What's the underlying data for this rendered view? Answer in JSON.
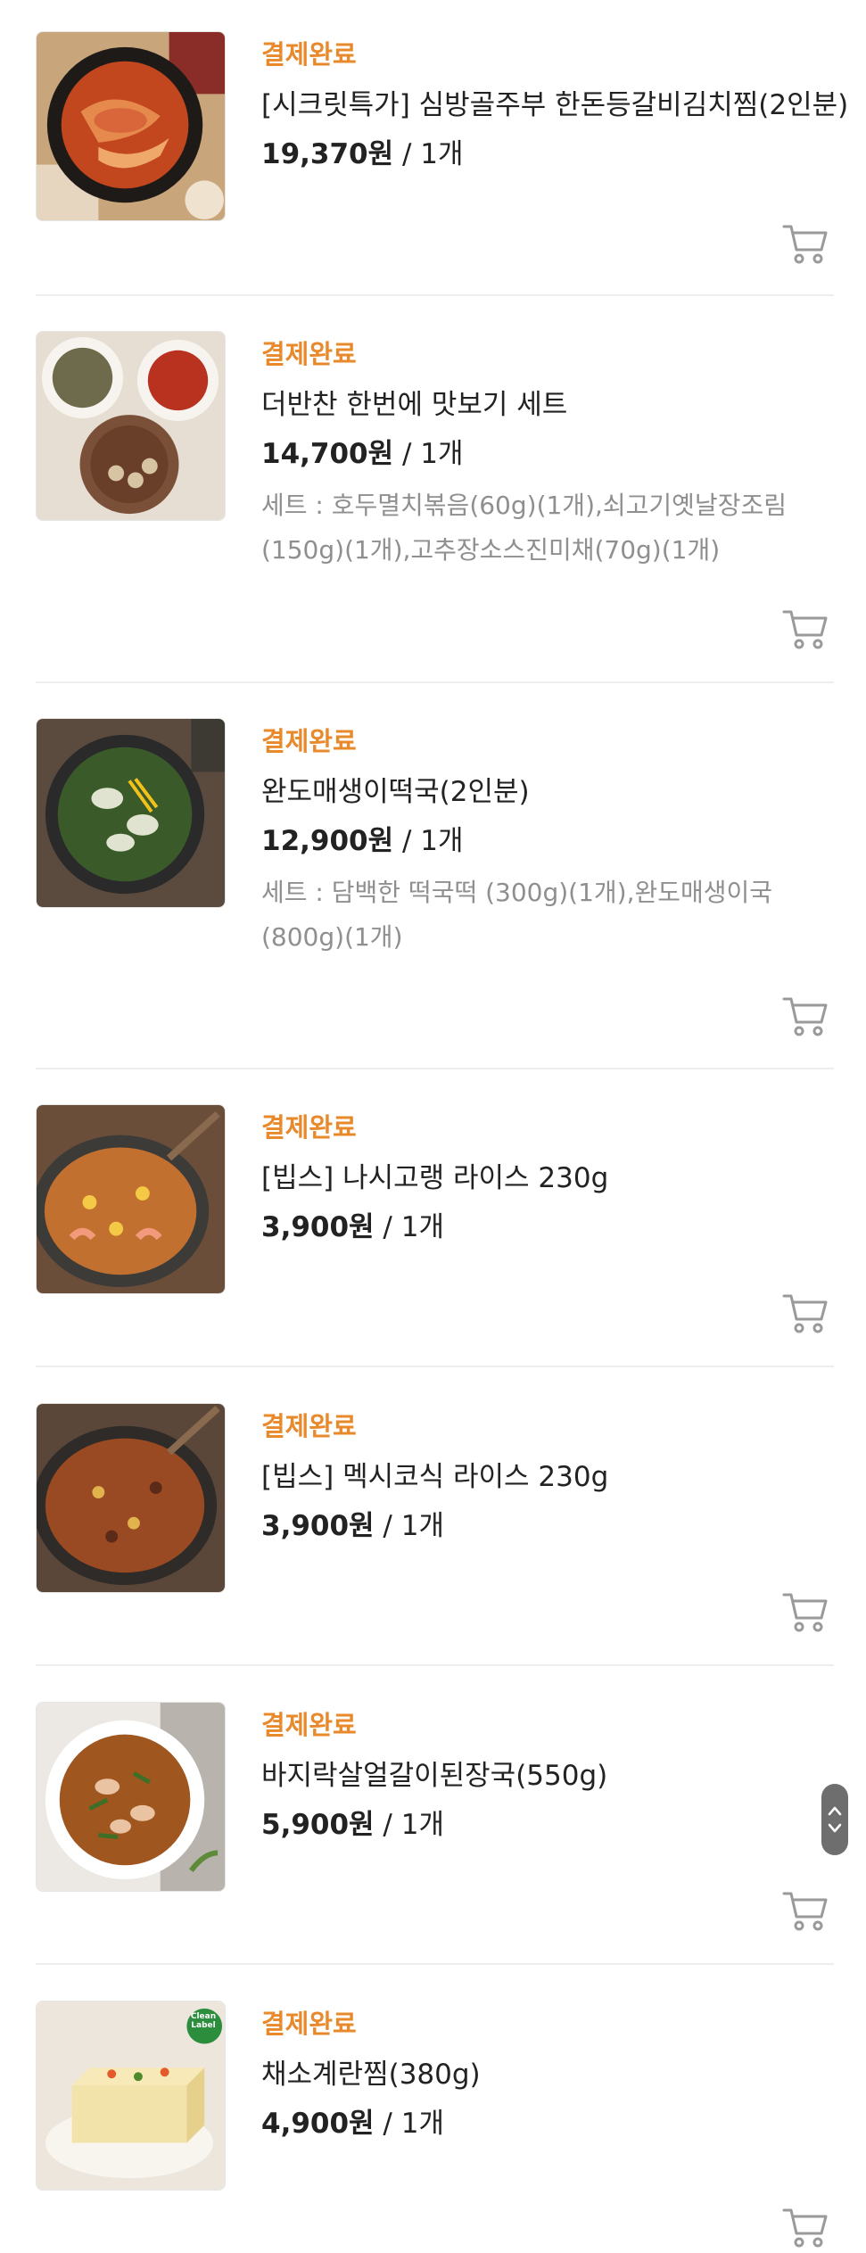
{
  "orders": [
    {
      "status": "결제완료",
      "name": "[시크릿특가] 심방골주부 한돈등갈비김치찜(2인분)",
      "price": "19,370원",
      "qty": " / 1개",
      "option": "",
      "image": "kimchi-ribs-stew"
    },
    {
      "status": "결제완료",
      "name": "더반찬 한번에 맛보기 세트",
      "price": "14,700원",
      "qty": " / 1개",
      "option": "세트 : 호두멸치볶음(60g)(1개),쇠고기옛날장조림(150g)(1개),고추장소스진미채(70g)(1개)",
      "image": "banchan-set"
    },
    {
      "status": "결제완료",
      "name": "완도매생이떡국(2인분)",
      "price": "12,900원",
      "qty": " / 1개",
      "option": "세트 : 담백한 떡국떡 (300g)(1개),완도매생이국(800g)(1개)",
      "image": "seaweed-rice-cake-soup"
    },
    {
      "status": "결제완료",
      "name": "[빕스] 나시고랭 라이스 230g",
      "price": "3,900원",
      "qty": " / 1개",
      "option": "",
      "image": "nasi-goreng"
    },
    {
      "status": "결제완료",
      "name": "[빕스] 멕시코식 라이스 230g",
      "price": "3,900원",
      "qty": " / 1개",
      "option": "",
      "image": "mexican-rice"
    },
    {
      "status": "결제완료",
      "name": "바지락살얼갈이된장국(550g)",
      "price": "5,900원",
      "qty": " / 1개",
      "option": "",
      "image": "clam-soybean-soup"
    },
    {
      "status": "결제완료",
      "name": "채소계란찜(380g)",
      "price": "4,900원",
      "qty": " / 1개",
      "option": "",
      "image": "vegetable-egg-custard",
      "badge": "Clean Label"
    }
  ],
  "icons": {
    "cart": "cart-icon",
    "scroll": "scroll-handle-icon"
  },
  "colors": {
    "status": "#e8892b",
    "option_text": "#8f8f8f",
    "divider": "#eeeeee"
  }
}
